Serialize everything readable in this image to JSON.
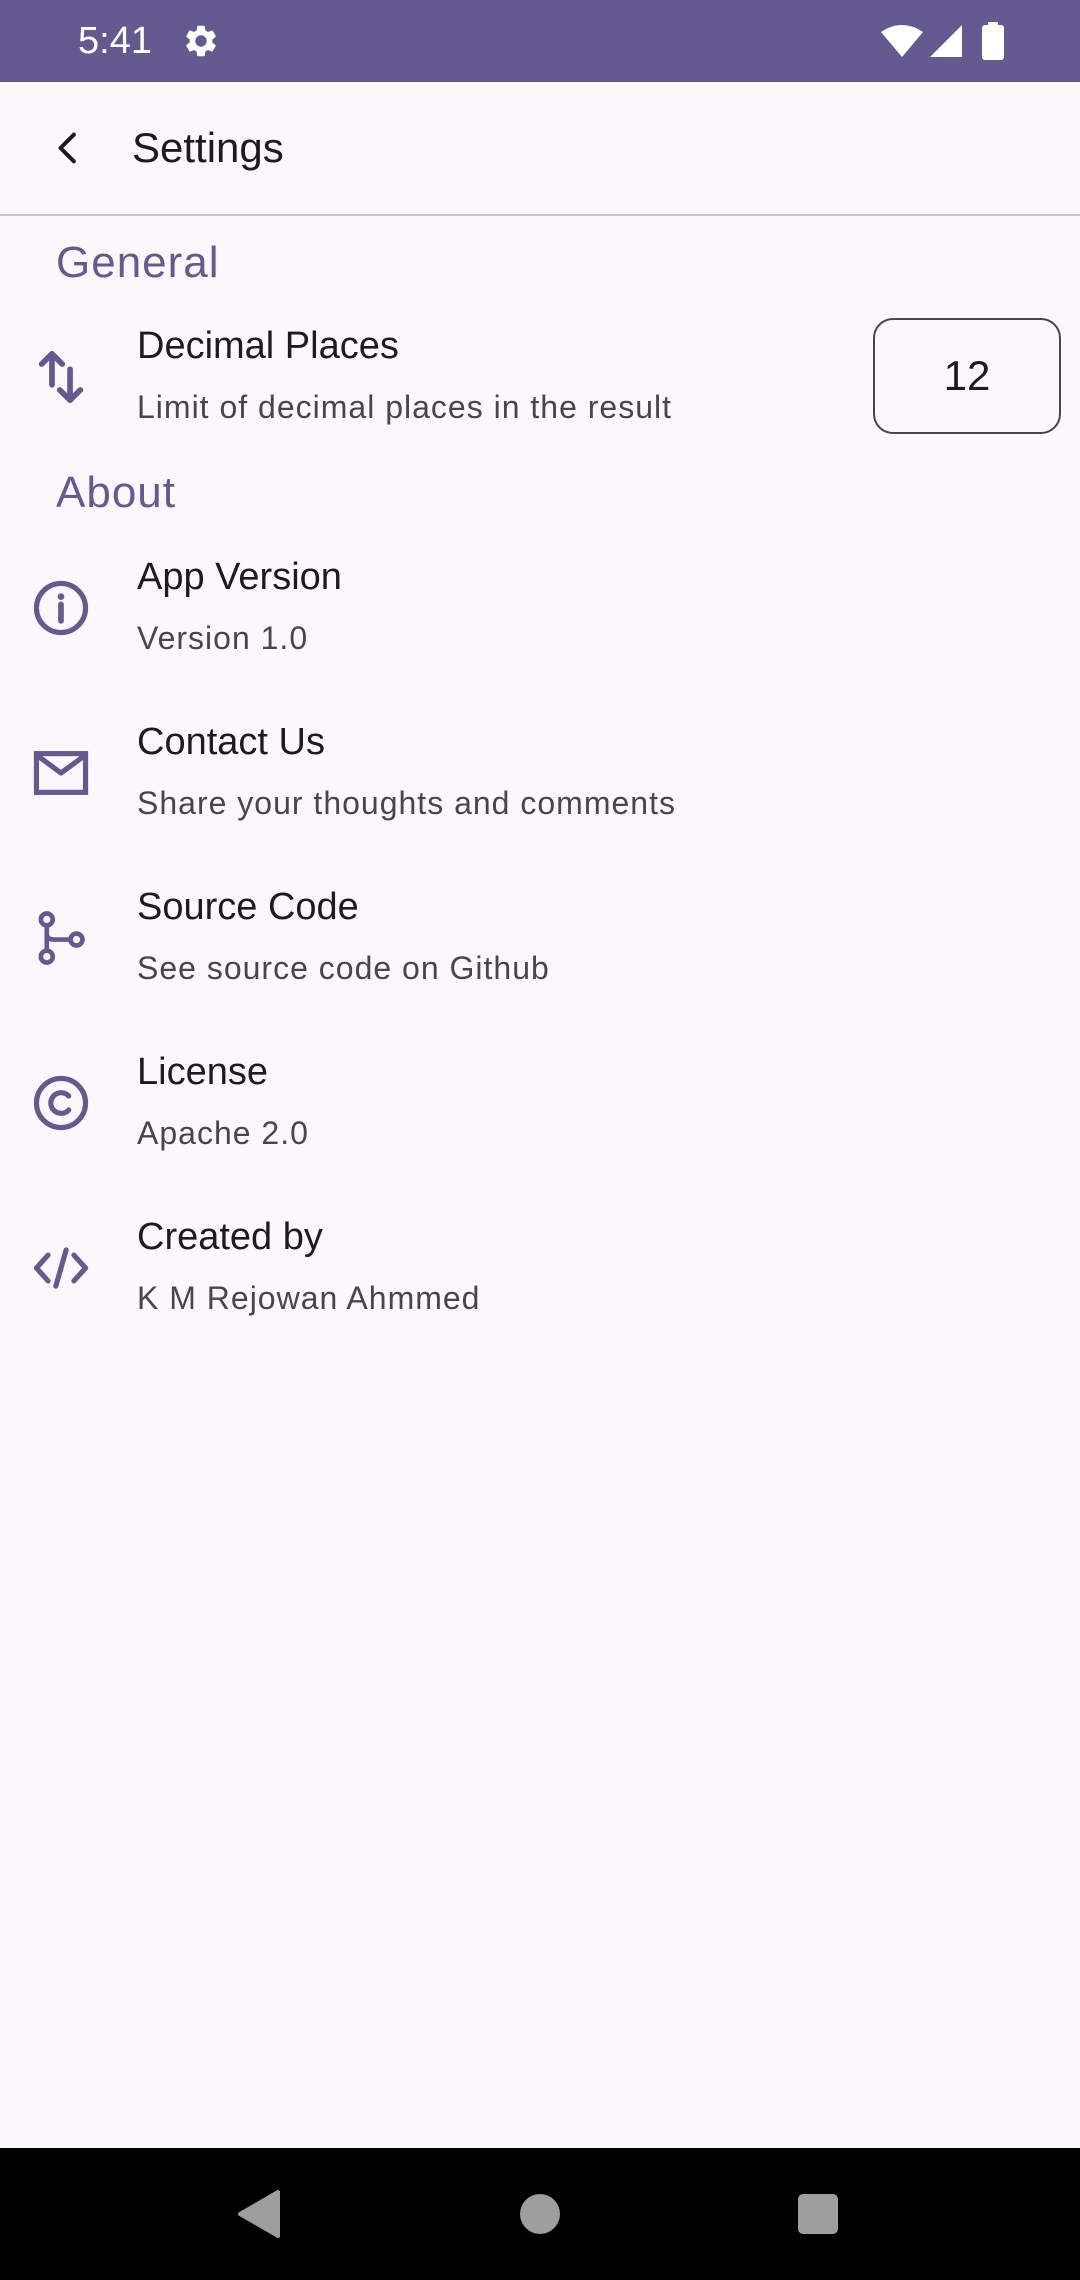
{
  "status_bar": {
    "time": "5:41",
    "background": "#645A8F",
    "icons": [
      "gear-icon",
      "wifi-icon",
      "cell-signal-icon",
      "battery-icon"
    ]
  },
  "app_bar": {
    "title": "Settings",
    "back_icon": "chevron-left-icon"
  },
  "sections": {
    "general": {
      "header": "General",
      "items": [
        {
          "title": "Decimal Places",
          "subtitle": "Limit of decimal places in the result",
          "icon": "swap-vertical-icon",
          "value": "12"
        }
      ]
    },
    "about": {
      "header": "About",
      "items": [
        {
          "title": "App Version",
          "subtitle": "Version 1.0",
          "icon": "info-icon"
        },
        {
          "title": "Contact Us",
          "subtitle": "Share your thoughts and comments",
          "icon": "mail-icon"
        },
        {
          "title": "Source Code",
          "subtitle": "See source code on Github",
          "icon": "git-branch-icon"
        },
        {
          "title": "License",
          "subtitle": "Apache 2.0",
          "icon": "copyright-icon"
        },
        {
          "title": "Created by",
          "subtitle": "K M Rejowan Ahmmed",
          "icon": "code-icon"
        }
      ]
    }
  },
  "nav_bar": {
    "buttons": [
      "back-triangle-icon",
      "home-circle-icon",
      "recents-square-icon"
    ]
  },
  "colors": {
    "accent": "#645A8F",
    "background": "#FCF7FC",
    "text_primary": "#1C1B1F",
    "text_secondary": "#49454F"
  }
}
